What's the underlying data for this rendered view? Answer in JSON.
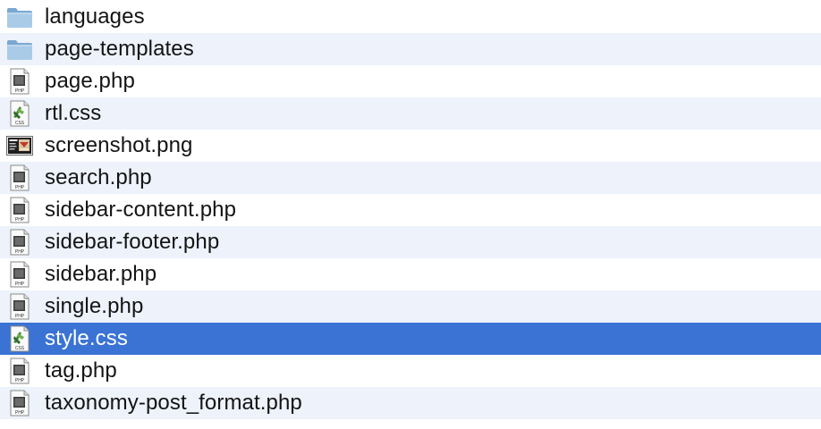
{
  "files": [
    {
      "name": "languages",
      "kind": "folder-icon"
    },
    {
      "name": "page-templates",
      "kind": "folder-icon"
    },
    {
      "name": "page.php",
      "kind": "php-file-icon"
    },
    {
      "name": "rtl.css",
      "kind": "css-file-icon"
    },
    {
      "name": "screenshot.png",
      "kind": "png-file-icon"
    },
    {
      "name": "search.php",
      "kind": "php-file-icon"
    },
    {
      "name": "sidebar-content.php",
      "kind": "php-file-icon"
    },
    {
      "name": "sidebar-footer.php",
      "kind": "php-file-icon"
    },
    {
      "name": "sidebar.php",
      "kind": "php-file-icon"
    },
    {
      "name": "single.php",
      "kind": "php-file-icon"
    },
    {
      "name": "style.css",
      "kind": "css-file-icon",
      "selected": true
    },
    {
      "name": "tag.php",
      "kind": "php-file-icon"
    },
    {
      "name": "taxonomy-post_format.php",
      "kind": "php-file-icon"
    }
  ],
  "icon_text": {
    "php": "PHP",
    "css": "CSS"
  },
  "colors": {
    "selection": "#3a73d4",
    "stripe": "#edf2fb",
    "folder": "#8fb8dc"
  }
}
